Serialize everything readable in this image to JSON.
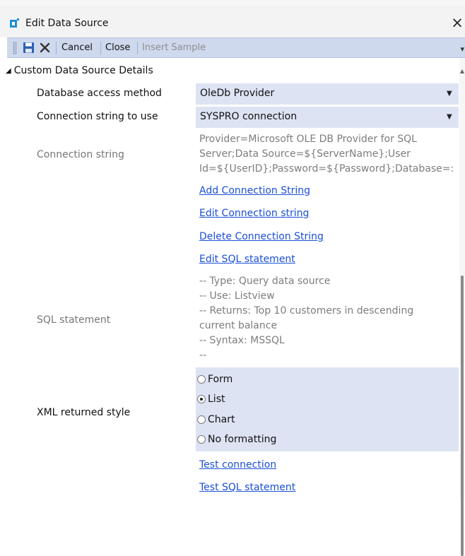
{
  "window": {
    "title": "Edit Data Source",
    "close_glyph": "×",
    "icon": "app-icon"
  },
  "toolbar": {
    "save_icon": "save-icon",
    "delete_icon": "delete-icon",
    "cancel_label": "Cancel",
    "close_label": "Close",
    "insert_sample_label": "Insert Sample",
    "overflow_glyph": "▾"
  },
  "details": {
    "group_title": "Custom Data Source Details",
    "db_access": {
      "label": "Database access method",
      "value": "OleDb Provider"
    },
    "conn_to_use": {
      "label": "Connection string to use",
      "value": "SYSPRO connection"
    },
    "conn_string": {
      "label": "Connection string",
      "lines": [
        "Provider=Microsoft OLE DB Provider for SQL",
        "Server;Data Source=${ServerName};User",
        "Id=${UserID};Password=${Password};Database=:"
      ]
    },
    "links": {
      "add_conn": "Add Connection String",
      "edit_conn": "Edit Connection string",
      "delete_conn": "Delete Connection String",
      "edit_sql": "Edit SQL statement",
      "test_conn": "Test connection",
      "test_sql": "Test SQL statement"
    },
    "sql": {
      "label": "SQL statement",
      "lines": [
        "-- Type: Query data source",
        "-- Use: Listview",
        "-- Returns: Top 10 customers in descending",
        "current balance",
        "-- Syntax: MSSQL",
        "--"
      ]
    },
    "xml_style": {
      "label": "XML returned style",
      "options": [
        "Form",
        "List",
        "Chart",
        "No formatting"
      ],
      "selected": "List"
    }
  },
  "colors": {
    "toolbar_bg": "#cfd9ee",
    "value_bg": "#dde3f3",
    "link": "#1a4fd6",
    "save_icon": "#2d5fb7",
    "app_icon": "#1e90d6"
  }
}
